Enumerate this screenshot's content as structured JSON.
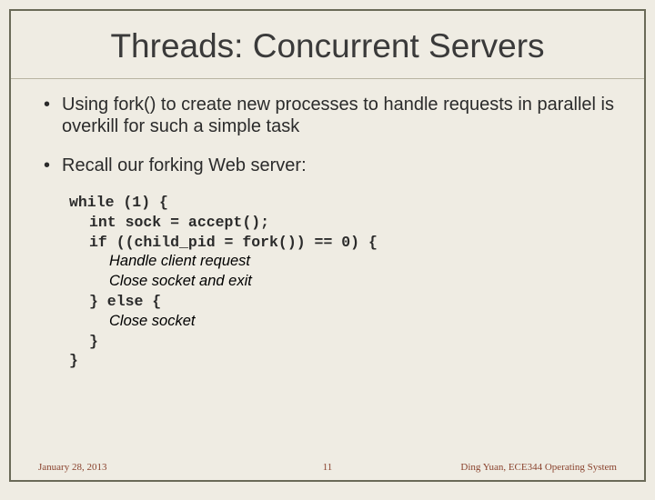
{
  "title": "Threads: Concurrent Servers",
  "bullets": {
    "b1": "Using fork() to create new processes to handle requests in parallel is overkill for such a simple task",
    "b2": "Recall our forking Web server:"
  },
  "code": {
    "l1": "while (1) {",
    "l2": "int sock = accept();",
    "l3": "if ((child_pid = fork()) == 0) {",
    "l4": "Handle client request",
    "l5": "Close socket and exit",
    "l6": "} else {",
    "l7": "Close socket",
    "l8": "}",
    "l9": "}"
  },
  "footer": {
    "date": "January 28, 2013",
    "page": "11",
    "author": "Ding Yuan, ECE344 Operating System"
  }
}
